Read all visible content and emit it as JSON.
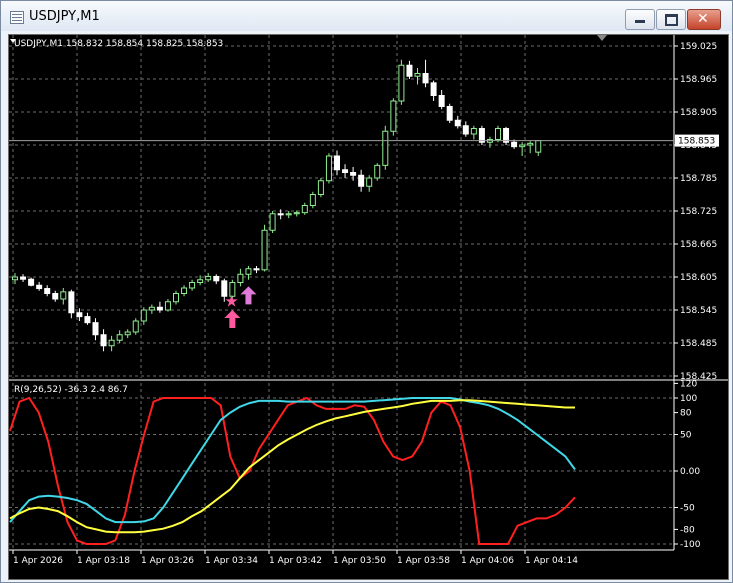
{
  "window": {
    "title": "USDJPY,M1",
    "icon": "chart-window-icon"
  },
  "chart": {
    "header": "USDJPY,M1  158.832 158.854 158.825 158.853",
    "current_price": "158.853",
    "price_ticks": [
      "159.025",
      "158.965",
      "158.905",
      "158.845",
      "158.785",
      "158.725",
      "158.665",
      "158.605",
      "158.545",
      "158.485",
      "158.425"
    ],
    "time_labels": [
      "1 Apr 2026",
      "1 Apr 03:18",
      "1 Apr 03:26",
      "1 Apr 03:34",
      "1 Apr 03:42",
      "1 Apr 03:50",
      "1 Apr 03:58",
      "1 Apr 04:06",
      "1 Apr 04:14"
    ],
    "candles_ohlc": [
      [
        158.6,
        158.612,
        158.592,
        158.605
      ],
      [
        158.605,
        158.61,
        158.596,
        158.601
      ],
      [
        158.601,
        158.604,
        158.588,
        158.59
      ],
      [
        158.59,
        158.596,
        158.58,
        158.584
      ],
      [
        158.584,
        158.59,
        158.57,
        158.575
      ],
      [
        158.575,
        158.58,
        158.56,
        158.565
      ],
      [
        158.565,
        158.585,
        158.555,
        158.578
      ],
      [
        158.578,
        158.582,
        158.53,
        158.54
      ],
      [
        158.54,
        158.548,
        158.525,
        158.533
      ],
      [
        158.533,
        158.54,
        158.518,
        158.522
      ],
      [
        158.522,
        158.53,
        158.49,
        158.5
      ],
      [
        158.5,
        158.51,
        158.47,
        158.48
      ],
      [
        158.48,
        158.498,
        158.47,
        158.49
      ],
      [
        158.49,
        158.508,
        158.485,
        158.5
      ],
      [
        158.5,
        158.51,
        158.494,
        158.505
      ],
      [
        158.505,
        158.53,
        158.5,
        158.525
      ],
      [
        158.525,
        158.55,
        158.518,
        158.545
      ],
      [
        158.545,
        158.555,
        158.538,
        158.55
      ],
      [
        158.55,
        158.56,
        158.54,
        158.545
      ],
      [
        158.545,
        158.565,
        158.542,
        158.56
      ],
      [
        158.56,
        158.58,
        158.555,
        158.575
      ],
      [
        158.575,
        158.59,
        158.57,
        158.585
      ],
      [
        158.585,
        158.6,
        158.58,
        158.595
      ],
      [
        158.595,
        158.608,
        158.59,
        158.6
      ],
      [
        158.6,
        158.612,
        158.596,
        158.606
      ],
      [
        158.606,
        158.61,
        158.592,
        158.598
      ],
      [
        158.598,
        158.602,
        158.56,
        158.57
      ],
      [
        158.57,
        158.6,
        158.56,
        158.595
      ],
      [
        158.595,
        158.62,
        158.588,
        158.61
      ],
      [
        158.61,
        158.625,
        158.6,
        158.62
      ],
      [
        158.62,
        158.625,
        158.612,
        158.618
      ],
      [
        158.618,
        158.7,
        158.615,
        158.69
      ],
      [
        158.69,
        158.725,
        158.685,
        158.72
      ],
      [
        158.72,
        158.728,
        158.71,
        158.718
      ],
      [
        158.718,
        158.725,
        158.712,
        158.72
      ],
      [
        158.72,
        158.726,
        158.715,
        158.722
      ],
      [
        158.722,
        158.74,
        158.718,
        158.735
      ],
      [
        158.735,
        158.76,
        158.73,
        158.755
      ],
      [
        158.755,
        158.785,
        158.75,
        158.78
      ],
      [
        158.78,
        158.83,
        158.775,
        158.825
      ],
      [
        158.825,
        158.835,
        158.79,
        158.8
      ],
      [
        158.8,
        158.81,
        158.785,
        158.795
      ],
      [
        158.795,
        158.805,
        158.78,
        158.79
      ],
      [
        158.79,
        158.8,
        158.76,
        158.77
      ],
      [
        158.77,
        158.79,
        158.76,
        158.785
      ],
      [
        158.785,
        158.812,
        158.78,
        158.808
      ],
      [
        158.808,
        158.88,
        158.8,
        158.87
      ],
      [
        158.87,
        158.93,
        158.862,
        158.925
      ],
      [
        158.925,
        159.0,
        158.918,
        158.99
      ],
      [
        158.99,
        158.998,
        158.965,
        158.97
      ],
      [
        158.97,
        158.985,
        158.955,
        158.975
      ],
      [
        158.975,
        159.0,
        158.95,
        158.958
      ],
      [
        158.958,
        158.962,
        158.925,
        158.935
      ],
      [
        158.935,
        158.945,
        158.91,
        158.915
      ],
      [
        158.915,
        158.92,
        158.885,
        158.89
      ],
      [
        158.89,
        158.898,
        158.875,
        158.88
      ],
      [
        158.88,
        158.888,
        158.86,
        158.865
      ],
      [
        158.865,
        158.88,
        158.855,
        158.875
      ],
      [
        158.875,
        158.88,
        158.845,
        158.85
      ],
      [
        158.85,
        158.86,
        158.84,
        158.855
      ],
      [
        158.855,
        158.88,
        158.85,
        158.875
      ],
      [
        158.875,
        158.878,
        158.845,
        158.85
      ],
      [
        158.85,
        158.855,
        158.838,
        158.842
      ],
      [
        158.842,
        158.85,
        158.825,
        158.845
      ],
      [
        158.845,
        158.852,
        158.83,
        158.848
      ],
      [
        158.832,
        158.854,
        158.825,
        158.853
      ]
    ],
    "arrows": [
      {
        "index": 27,
        "price": 158.545,
        "type": "buy-arrow",
        "color": "#ff5aa0"
      },
      {
        "index": 29,
        "price": 158.588,
        "type": "buy-arrow",
        "color": "#e07ad8"
      },
      {
        "index": 27,
        "price": 158.562,
        "type": "star",
        "color": "#ff5aa0"
      }
    ],
    "colors": {
      "bull": "#90ee90",
      "bear": "#ffffff",
      "grid": "#6b6b6b"
    }
  },
  "indicator": {
    "label": "R(9,26,52) -36.3 2.4 86.7",
    "levels": [
      "120",
      "100",
      "80",
      "50",
      "0.00",
      "-50",
      "-80",
      "-100"
    ],
    "series": [
      {
        "color": "#ff2020",
        "values": [
          55,
          95,
          100,
          80,
          40,
          -20,
          -70,
          -95,
          -100,
          -100,
          -100,
          -95,
          -60,
          0,
          50,
          95,
          100,
          100,
          100,
          100,
          100,
          100,
          90,
          20,
          -10,
          0,
          30,
          50,
          70,
          90,
          95,
          100,
          90,
          85,
          85,
          85,
          90,
          88,
          70,
          40,
          20,
          15,
          20,
          40,
          80,
          95,
          90,
          60,
          0,
          -100,
          -100,
          -100,
          -100,
          -75,
          -70,
          -65,
          -65,
          -60,
          -50,
          -36
        ]
      },
      {
        "color": "#40d8e8",
        "values": [
          -70,
          -55,
          -40,
          -35,
          -34,
          -35,
          -37,
          -40,
          -45,
          -55,
          -65,
          -70,
          -70,
          -70,
          -69,
          -65,
          -50,
          -30,
          -10,
          10,
          30,
          50,
          70,
          80,
          88,
          93,
          96,
          96,
          96,
          95,
          95,
          95,
          95,
          95,
          95,
          95,
          95,
          95,
          96,
          97,
          98,
          99,
          100,
          100,
          100,
          100,
          100,
          98,
          95,
          93,
          90,
          85,
          78,
          70,
          60,
          50,
          40,
          30,
          20,
          2
        ]
      },
      {
        "color": "#ffff40",
        "values": [
          -65,
          -58,
          -52,
          -50,
          -52,
          -55,
          -62,
          -70,
          -77,
          -80,
          -83,
          -84,
          -84,
          -84,
          -83,
          -81,
          -79,
          -75,
          -70,
          -62,
          -55,
          -45,
          -35,
          -25,
          -10,
          5,
          15,
          25,
          35,
          43,
          50,
          57,
          63,
          68,
          72,
          75,
          78,
          81,
          83,
          85,
          87,
          89,
          92,
          94,
          96,
          96,
          96,
          97,
          97,
          96,
          95,
          94,
          93,
          92,
          91,
          90,
          89,
          88,
          87,
          87
        ]
      }
    ]
  }
}
